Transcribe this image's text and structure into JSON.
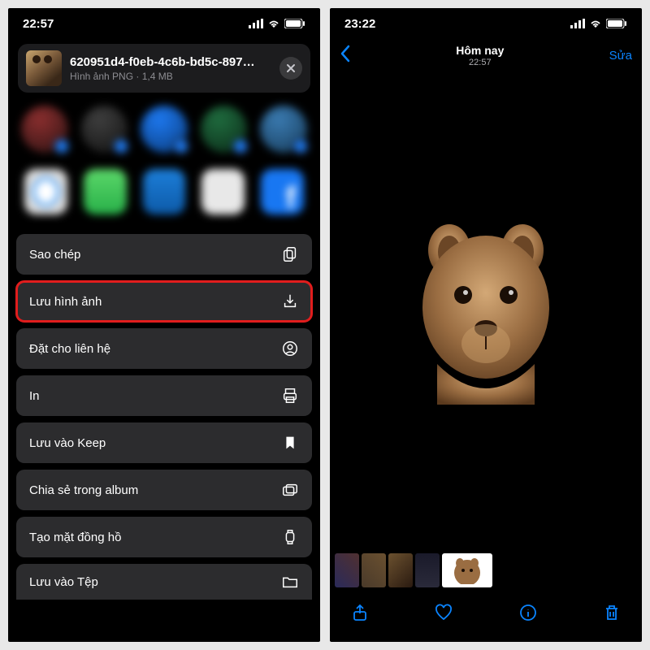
{
  "left": {
    "status": {
      "time": "22:57"
    },
    "file": {
      "name": "620951d4-f0eb-4c6b-bd5c-897…",
      "meta": "Hình ảnh PNG · 1,4 MB"
    },
    "actions": [
      {
        "label": "Sao chép",
        "icon": "copy-icon"
      },
      {
        "label": "Lưu hình ảnh",
        "icon": "download-icon",
        "highlight": true
      },
      {
        "label": "Đặt cho liên hệ",
        "icon": "contact-icon"
      },
      {
        "label": "In",
        "icon": "printer-icon"
      },
      {
        "label": "Lưu vào Keep",
        "icon": "bookmark-icon"
      },
      {
        "label": "Chia sẻ trong album",
        "icon": "shared-album-icon"
      },
      {
        "label": "Tạo mặt đồng hồ",
        "icon": "watch-icon"
      },
      {
        "label": "Lưu vào Tệp",
        "icon": "folder-icon"
      }
    ]
  },
  "right": {
    "status": {
      "time": "23:22"
    },
    "nav": {
      "title": "Hôm nay",
      "subtitle": "22:57",
      "edit": "Sửa"
    }
  }
}
